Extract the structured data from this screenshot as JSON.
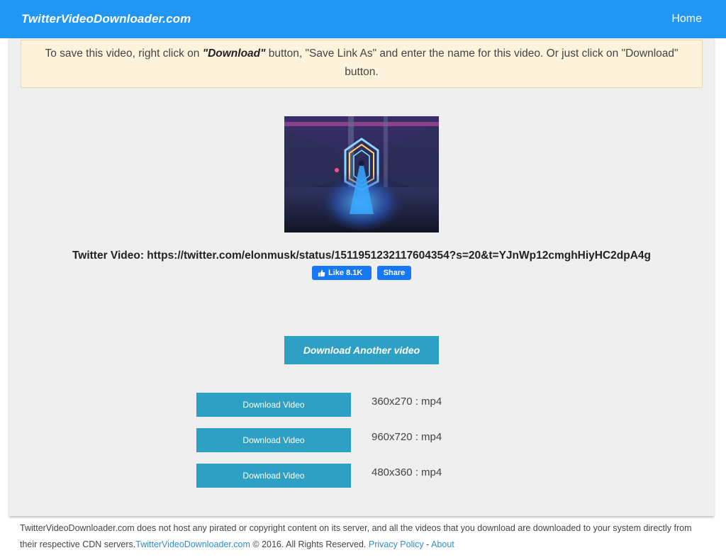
{
  "navbar": {
    "brand": "TwitterVideoDownloader.com",
    "home": "Home"
  },
  "notice": {
    "text_before": "To save this video, right click on ",
    "emphasis": "\"Download\"",
    "text_after": " button, \"Save Link As\" and enter the name for this video. Or just click on \"Download\" button."
  },
  "video": {
    "title": "Twitter Video: https://twitter.com/elonmusk/status/1511951232117604354?s=20&t=YJnWp12cmghHiyHC2dpA4g"
  },
  "social": {
    "like_label": "Like 8.1K",
    "share_label": "Share"
  },
  "actions": {
    "another_label": "Download Another video"
  },
  "downloads": [
    {
      "button": "Download Video",
      "format": "360x270 : mp4"
    },
    {
      "button": "Download Video",
      "format": "960x720 : mp4"
    },
    {
      "button": "Download Video",
      "format": "480x360 : mp4"
    }
  ],
  "footer": {
    "text": "TwitterVideoDownloader.com does not host any pirated or copyright content on its server, and all the videos that you download are downloaded to your system directly from their respective CDN servers.",
    "site_link": "TwitterVideoDownloader.com",
    "copyright": " © 2016. All Rights Reserved. ",
    "privacy_link": "Privacy Policy",
    "separator": " - ",
    "about_link": "About"
  },
  "colors": {
    "navbar": "#2196f3",
    "button": "#2ea0c4",
    "facebook": "#1877f2",
    "notice_bg": "#fdf3dc"
  }
}
